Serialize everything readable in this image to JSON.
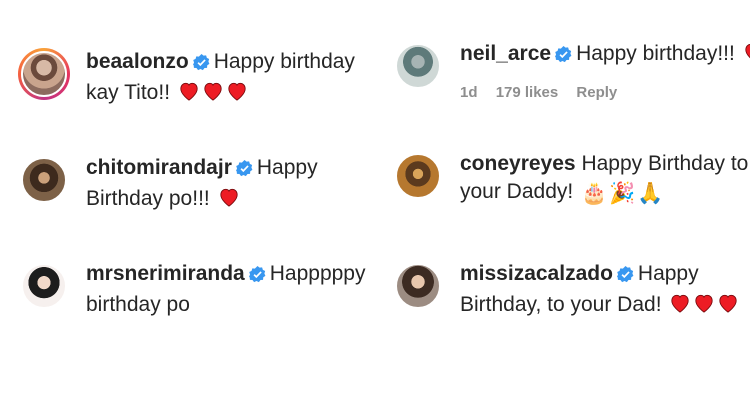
{
  "comments": [
    {
      "username": "beaalonzo",
      "verified": true,
      "text": "Happy birthday kay Tito!!",
      "emojis": [
        "heart",
        "heart",
        "heart"
      ],
      "story_ring": true
    },
    {
      "username": "neil_arce",
      "verified": true,
      "text": "Happy birthday!!!",
      "emojis": [
        "heart"
      ],
      "meta": {
        "age": "1d",
        "likes": "179 likes",
        "reply": "Reply"
      }
    },
    {
      "username": "chitomirandajr",
      "verified": true,
      "text": "Happy Birthday po!!!",
      "emojis": [
        "heart"
      ]
    },
    {
      "username": "coneyreyes",
      "verified": false,
      "text": "Happy Birthday to your Daddy!",
      "emojis": [
        "cake",
        "party-popper",
        "folded-hands"
      ]
    },
    {
      "username": "mrsnerimiranda",
      "verified": true,
      "text": "Happpppy birthday po",
      "emojis": []
    },
    {
      "username": "missizacalzado",
      "verified": true,
      "text": "Happy Birthday, to your Dad!",
      "emojis": [
        "heart",
        "heart",
        "heart"
      ]
    }
  ],
  "colors": {
    "verified": "#3897f0",
    "heart": "#ed1c24",
    "meta": "#8e8e8e"
  },
  "glyphs": {
    "cake": "🎂",
    "party-popper": "🎉",
    "folded-hands": "🙏"
  }
}
